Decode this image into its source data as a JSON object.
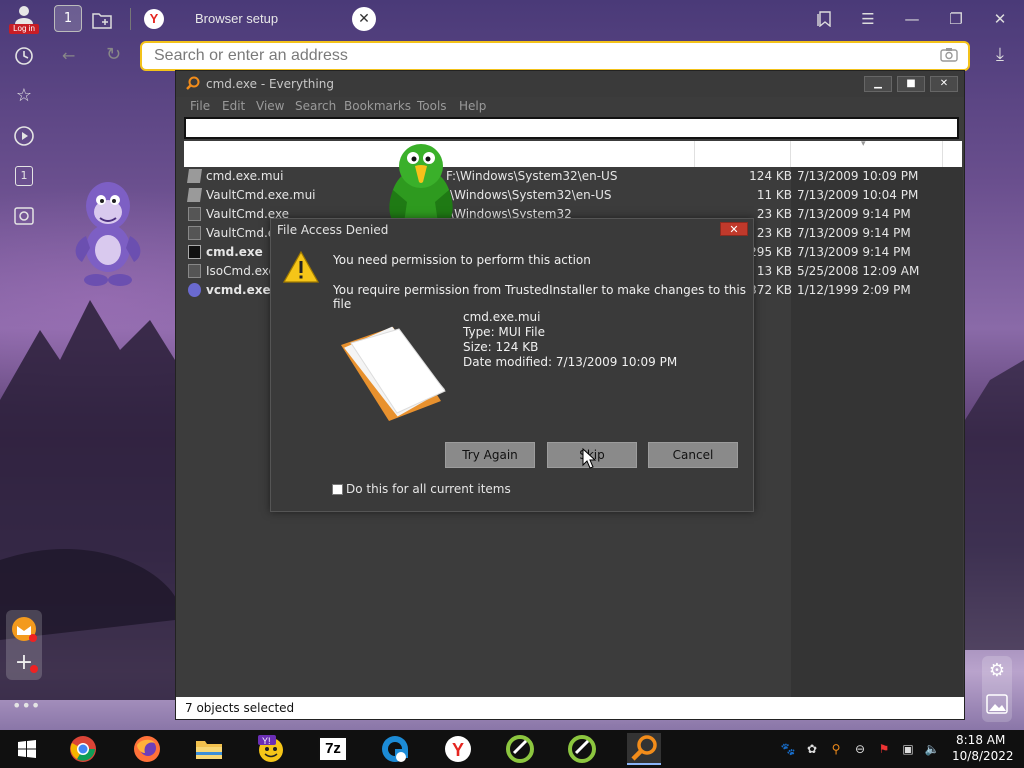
{
  "browser": {
    "login_label": "Log in",
    "tabs_count": "1",
    "active_tab_title": "Browser setup",
    "favicon_letter": "Y",
    "address_placeholder": "Search or enter an address"
  },
  "sidebar": {
    "items": [
      "history-icon",
      "bookmarks-icon",
      "media-icon",
      "tab-count-icon",
      "screenshot-icon"
    ],
    "tab_number": "1"
  },
  "everything": {
    "title": "cmd.exe - Everything",
    "menu": [
      "File",
      "Edit",
      "View",
      "Search",
      "Bookmarks",
      "Tools",
      "Help"
    ],
    "search_value": "",
    "files": [
      {
        "name": "cmd.exe.mui",
        "path": "F:\\Windows\\System32\\en-US",
        "size": "124 KB",
        "date": "7/13/2009 10:09 PM",
        "bold": false,
        "icon": "mui-file-icon"
      },
      {
        "name": "VaultCmd.exe.mui",
        "path": ":\\Windows\\System32\\en-US",
        "size": "11 KB",
        "date": "7/13/2009 10:04 PM",
        "bold": false,
        "icon": "mui-file-icon"
      },
      {
        "name": "VaultCmd.exe",
        "path": ":\\Windows\\System32",
        "size": "23 KB",
        "date": "7/13/2009 9:14 PM",
        "bold": false,
        "icon": "exe-icon"
      },
      {
        "name": "VaultCmd.e",
        "path": "",
        "size": "23 KB",
        "date": "7/13/2009 9:14 PM",
        "bold": false,
        "icon": "exe-icon"
      },
      {
        "name": "cmd.exe",
        "path": "",
        "size": "295 KB",
        "date": "7/13/2009 9:14 PM",
        "bold": true,
        "icon": "cmd-icon"
      },
      {
        "name": "IsoCmd.exe",
        "path": "",
        "size": "13 KB",
        "date": "5/25/2008 12:09 AM",
        "bold": false,
        "icon": "exe-icon"
      },
      {
        "name": "vcmd.exe",
        "path": "",
        "size": "372 KB",
        "date": "1/12/1999 2:09 PM",
        "bold": true,
        "icon": "vcmd-icon"
      }
    ],
    "status": "7 objects selected"
  },
  "dialog": {
    "title": "File Access Denied",
    "message1": "You need permission to perform this action",
    "message2": "You require permission from TrustedInstaller to make changes to this file",
    "file_name": "cmd.exe.mui",
    "file_type": "Type: MUI File",
    "file_size": "Size: 124 KB",
    "file_date": "Date modified: 7/13/2009 10:09 PM",
    "buttons": {
      "try_again": "Try Again",
      "skip": "Skip",
      "cancel": "Cancel"
    },
    "checkbox_label": "Do this for all current items",
    "checkbox_checked": false
  },
  "taskbar": {
    "apps": [
      "windows-start-icon",
      "chrome-icon",
      "firefox-icon",
      "file-explorer-icon",
      "yahoo-messenger-icon",
      "7zip-icon",
      "browser-e-icon",
      "yandex-icon",
      "app-green-icon",
      "app-green2-icon",
      "everything-search-icon"
    ],
    "sevenzip_label": "7z",
    "clock_time": "8:18 AM",
    "clock_date": "10/8/2022"
  },
  "colors": {
    "address_border": "#f3c21a",
    "accent_red": "#c81d25",
    "dialog_bg": "#3a3a3a"
  }
}
